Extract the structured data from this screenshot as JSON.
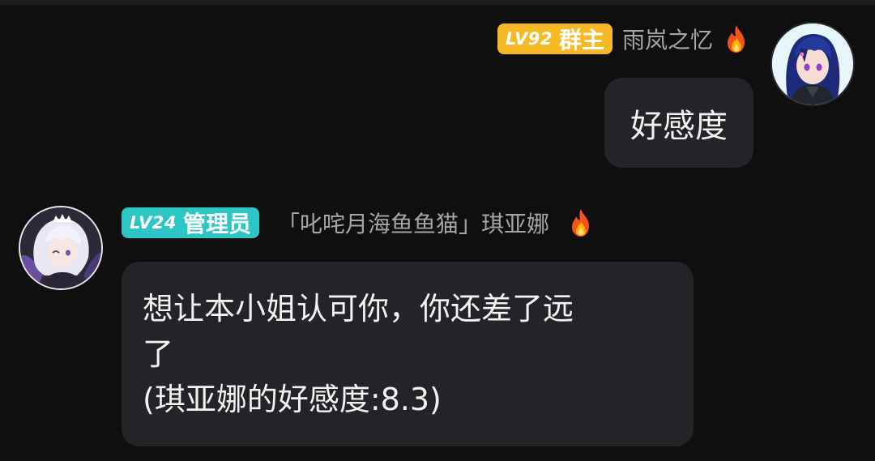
{
  "messages": [
    {
      "side": "right",
      "badge": {
        "level": "LV92",
        "role": "群主",
        "color": "#f6b924"
      },
      "nickname": "雨岚之忆",
      "flame_icon": "fire-icon",
      "avatar_icon": "anime-girl-blue-hair-avatar",
      "text": "好感度"
    },
    {
      "side": "left",
      "badge": {
        "level": "LV24",
        "role": "管理员",
        "color": "#2cc6c4"
      },
      "nickname": "「叱咤月海鱼鱼猫」琪亚娜",
      "flame_icon": "fire-icon",
      "avatar_icon": "anime-girl-white-hair-avatar",
      "text_lines": [
        "想让本小姐认可你，你还差了远",
        "了",
        "(琪亚娜的好感度:8.3)"
      ]
    }
  ],
  "colors": {
    "background": "#0f0f10",
    "bubble": "#232427",
    "nickname": "#a6a6aa",
    "text": "#f2f2f2"
  }
}
